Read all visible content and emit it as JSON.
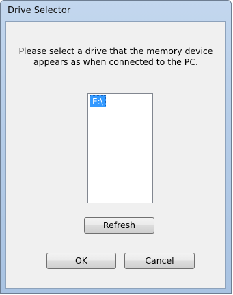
{
  "window": {
    "title": "Drive Selector"
  },
  "message": {
    "line1": "Please select a drive that the memory device",
    "line2": "appears as when connected to the PC."
  },
  "drive_list": {
    "items": [
      {
        "label": "E:\\",
        "selected": true
      }
    ]
  },
  "buttons": {
    "refresh": "Refresh",
    "ok": "OK",
    "cancel": "Cancel"
  },
  "colors": {
    "selection": "#3399ff",
    "titlebar": "#b6cde8",
    "client_background": "#f0f0f0"
  }
}
